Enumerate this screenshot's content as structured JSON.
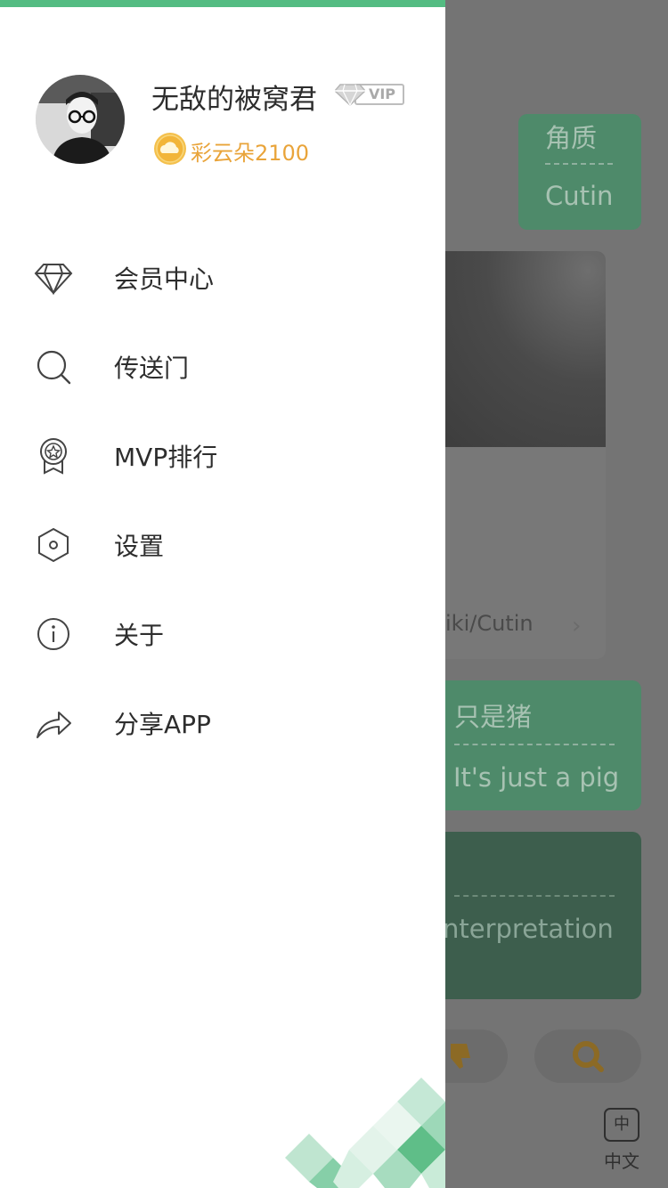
{
  "background": {
    "card1": {
      "line1": "角质",
      "line2": "Cutin"
    },
    "image_card": {
      "link": "iki/Cutin",
      "chevron": "›"
    },
    "card2": {
      "line1": "只是猪",
      "line2": "It's just a pig"
    },
    "card3": {
      "line2": "nterpretation"
    },
    "buttons": {
      "dislike_icon": "thumbs-down-icon",
      "search_icon": "search-icon"
    },
    "language": {
      "box": "中",
      "label": "中文"
    }
  },
  "drawer": {
    "accent_color": "#54bc82",
    "user": {
      "name": "无敌的被窝君",
      "vip_badge": "VIP",
      "coins": "彩云朵2100"
    },
    "menu": [
      {
        "label": "会员中心",
        "icon": "diamond-icon"
      },
      {
        "label": "传送门",
        "icon": "search-icon"
      },
      {
        "label": "MVP排行",
        "icon": "medal-icon"
      },
      {
        "label": "设置",
        "icon": "settings-hexagon-icon"
      },
      {
        "label": "关于",
        "icon": "info-icon"
      },
      {
        "label": "分享APP",
        "icon": "share-arrow-icon"
      }
    ]
  }
}
